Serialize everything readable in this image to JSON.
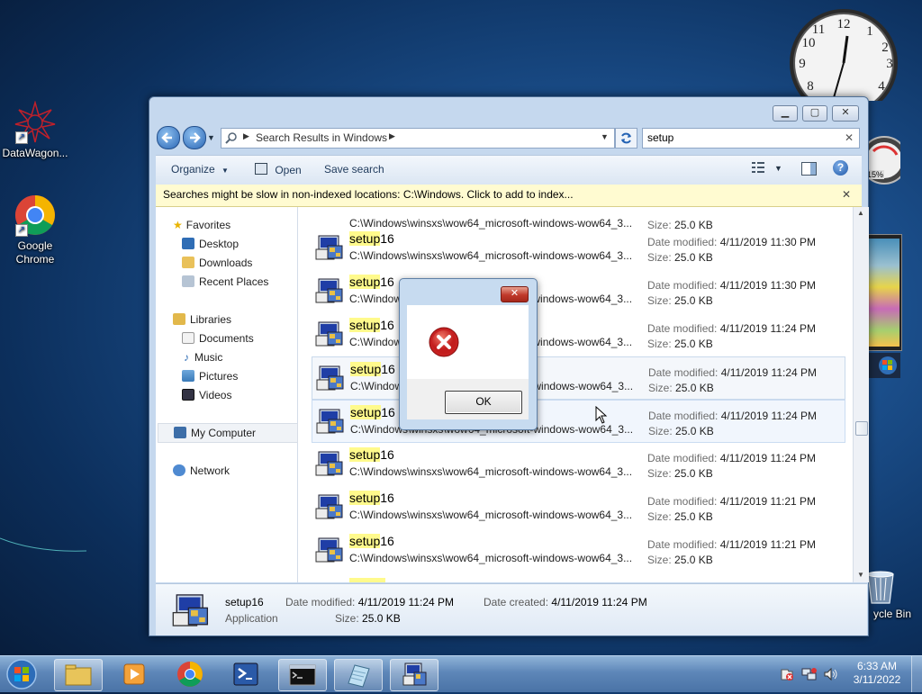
{
  "desktop": {
    "icons": [
      {
        "label": "DataWagon..."
      },
      {
        "label": "Google Chrome"
      },
      {
        "label": "ycle Bin"
      }
    ]
  },
  "window": {
    "address": {
      "path": "Search Results in Windows"
    },
    "search": {
      "value": "setup"
    },
    "toolbar": {
      "organize": "Organize",
      "open": "Open",
      "save_search": "Save search"
    },
    "infobar": {
      "text": "Searches might be slow in non-indexed locations: C:\\Windows. Click to add to index..."
    },
    "nav": {
      "favorites": "Favorites",
      "desktop": "Desktop",
      "downloads": "Downloads",
      "recent": "Recent Places",
      "libraries": "Libraries",
      "documents": "Documents",
      "music": "Music",
      "pictures": "Pictures",
      "videos": "Videos",
      "computer": "My Computer",
      "network": "Network"
    },
    "results": {
      "date_label": "Date modified:",
      "size_label": "Size:",
      "partial_top_path": "C:\\Windows\\winsxs\\wow64_microsoft-windows-wow64_3...",
      "partial_top_size": "25.0 KB",
      "rows": [
        {
          "name_hl": "setup",
          "name_rest": "16",
          "path": "C:\\Windows\\winsxs\\wow64_microsoft-windows-wow64_3...",
          "date": "4/11/2019 11:30 PM",
          "size": "25.0 KB"
        },
        {
          "name_hl": "setup",
          "name_rest": "16",
          "path": "C:\\Windows\\winsxs\\wow64_microsoft-windows-wow64_3...",
          "date": "4/11/2019 11:30 PM",
          "size": "25.0 KB"
        },
        {
          "name_hl": "setup",
          "name_rest": "16",
          "path": "C:\\Windows\\winsxs\\wow64_microsoft-windows-wow64_3...",
          "date": "4/11/2019 11:24 PM",
          "size": "25.0 KB"
        },
        {
          "name_hl": "setup",
          "name_rest": "16",
          "path": "C:\\Windows\\winsxs\\wow64_microsoft-windows-wow64_3...",
          "date": "4/11/2019 11:24 PM",
          "size": "25.0 KB"
        },
        {
          "name_hl": "setup",
          "name_rest": "16",
          "path": "C:\\Windows\\winsxs\\wow64_microsoft-windows-wow64_3...",
          "date": "4/11/2019 11:24 PM",
          "size": "25.0 KB"
        },
        {
          "name_hl": "setup",
          "name_rest": "16",
          "path": "C:\\Windows\\winsxs\\wow64_microsoft-windows-wow64_3...",
          "date": "4/11/2019 11:24 PM",
          "size": "25.0 KB"
        },
        {
          "name_hl": "setup",
          "name_rest": "16",
          "path": "C:\\Windows\\winsxs\\wow64_microsoft-windows-wow64_3...",
          "date": "4/11/2019 11:21 PM",
          "size": "25.0 KB"
        },
        {
          "name_hl": "setup",
          "name_rest": "16",
          "path": "C:\\Windows\\winsxs\\wow64_microsoft-windows-wow64_3...",
          "date": "4/11/2019 11:21 PM",
          "size": "25.0 KB"
        }
      ]
    },
    "details": {
      "name": "setup16",
      "type": "Application",
      "date_modified_label": "Date modified:",
      "date_modified": "4/11/2019 11:24 PM",
      "date_created_label": "Date created:",
      "date_created": "4/11/2019 11:24 PM",
      "size_label": "Size:",
      "size": "25.0 KB"
    }
  },
  "dialog": {
    "ok_label": "OK"
  },
  "gadgets": {
    "cpu_percent": "15%"
  },
  "taskbar": {
    "time": "6:33 AM",
    "date": "3/11/2022"
  },
  "colors": {
    "highlight": "#fffa8c",
    "error_red": "#d01f1f",
    "link_blue": "#1e395b"
  }
}
